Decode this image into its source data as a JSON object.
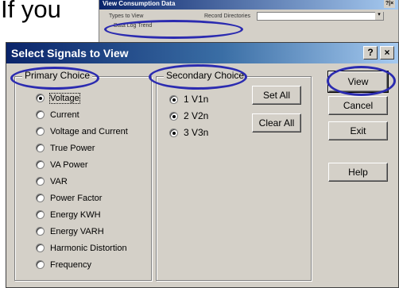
{
  "doc": {
    "text": "If you"
  },
  "background_window": {
    "title": "View Consumption Data",
    "close_label": "?|×",
    "types_label": "Types to View",
    "recent_label": "Record Directories",
    "datalog_label": "Data Log Trend"
  },
  "dialog": {
    "title": "Select Signals to View",
    "help_btn": "?",
    "close_btn": "×"
  },
  "primary": {
    "legend": "Primary Choice",
    "items": [
      {
        "label": "Voltage",
        "checked": true
      },
      {
        "label": "Current",
        "checked": false
      },
      {
        "label": "Voltage and Current",
        "checked": false
      },
      {
        "label": "True Power",
        "checked": false
      },
      {
        "label": "VA Power",
        "checked": false
      },
      {
        "label": "VAR",
        "checked": false
      },
      {
        "label": "Power Factor",
        "checked": false
      },
      {
        "label": "Energy KWH",
        "checked": false
      },
      {
        "label": "Energy VARH",
        "checked": false
      },
      {
        "label": "Harmonic Distortion",
        "checked": false
      },
      {
        "label": "Frequency",
        "checked": false
      }
    ]
  },
  "secondary": {
    "legend": "Secondary Choice",
    "items": [
      {
        "label": "1 V1n",
        "checked": true
      },
      {
        "label": "2 V2n",
        "checked": true
      },
      {
        "label": "3 V3n",
        "checked": true
      }
    ],
    "set_all": "Set All",
    "clear_all": "Clear All"
  },
  "actions": {
    "view": "View",
    "cancel": "Cancel",
    "exit": "Exit",
    "help": "Help"
  },
  "colors": {
    "annotation": "#2b2bb0",
    "titlebar_start": "#0a246a",
    "titlebar_end": "#a6caf0",
    "dialog_face": "#d4d0c8"
  }
}
